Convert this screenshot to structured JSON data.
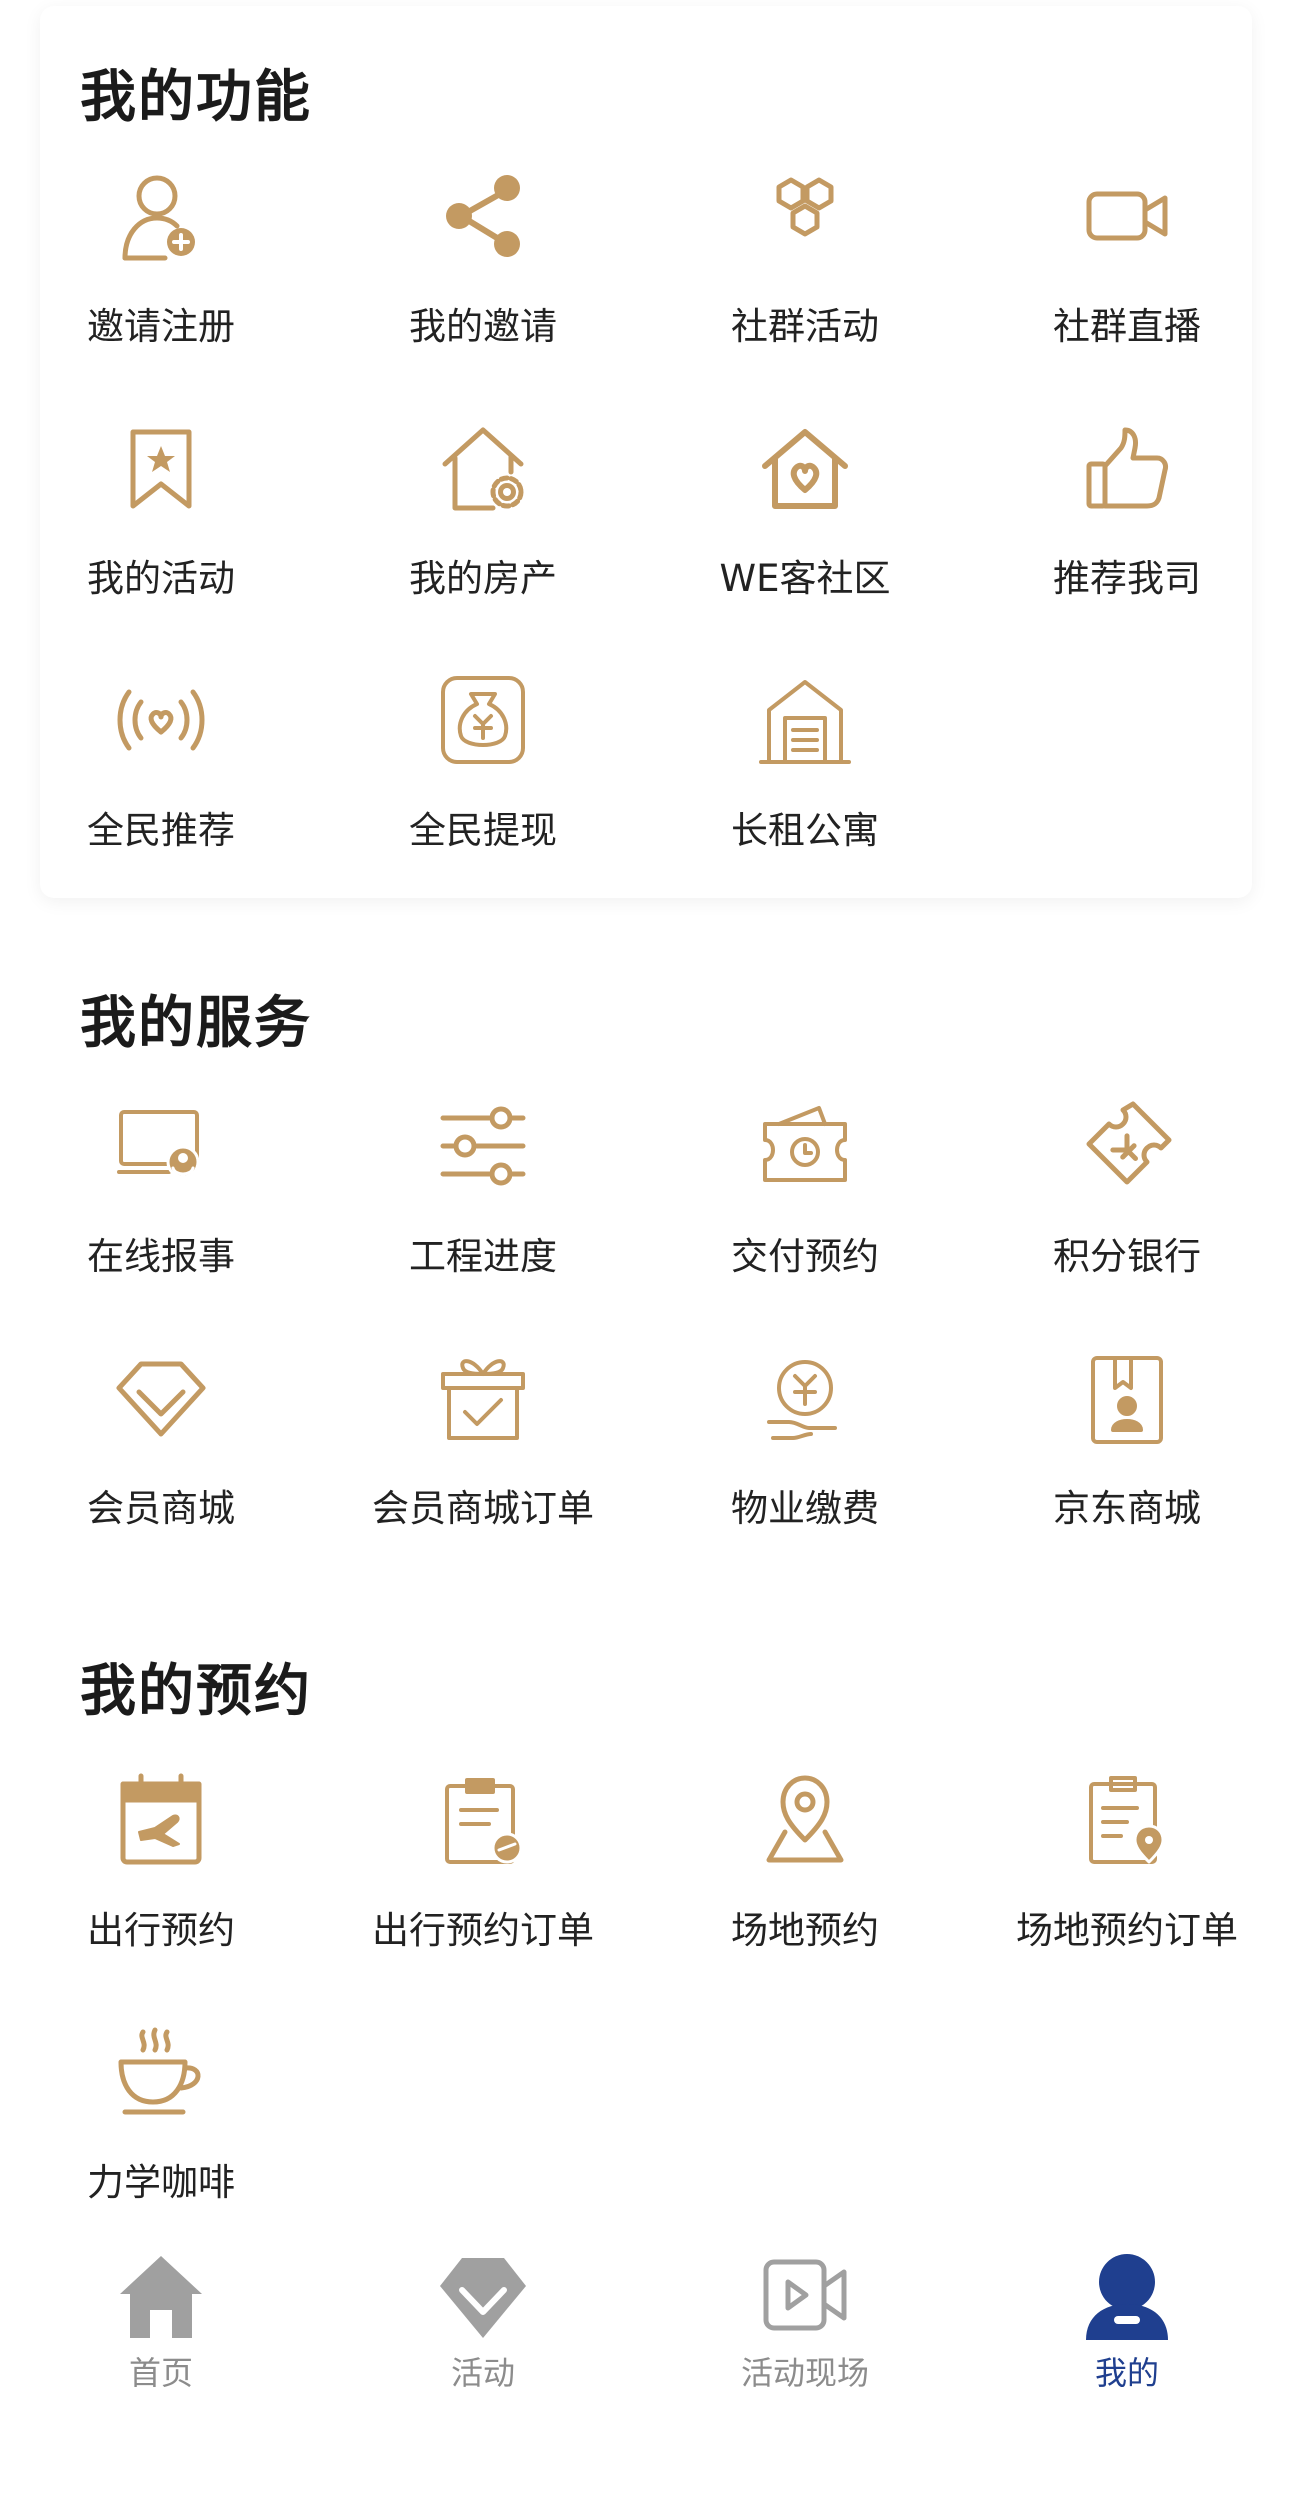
{
  "colors": {
    "accent": "#c39a62",
    "tab_inactive": "#a0a0a0",
    "tab_active": "#1f3f8f",
    "title": "#1b1b1b",
    "label": "#222222"
  },
  "functions": {
    "title": "我的功能",
    "items": [
      {
        "label": "邀请注册",
        "icon": "user-add-icon"
      },
      {
        "label": "我的邀请",
        "icon": "share-icon"
      },
      {
        "label": "社群活动",
        "icon": "hexagons-icon"
      },
      {
        "label": "社群直播",
        "icon": "video-camera-icon"
      },
      {
        "label": "我的活动",
        "icon": "bookmark-star-icon"
      },
      {
        "label": "我的房产",
        "icon": "house-gear-icon"
      },
      {
        "label": "WE客社区",
        "icon": "house-heart-icon"
      },
      {
        "label": "推荐我司",
        "icon": "thumbs-up-icon"
      },
      {
        "label": "全民推荐",
        "icon": "broadcast-heart-icon"
      },
      {
        "label": "全民提现",
        "icon": "money-bag-icon"
      },
      {
        "label": "长租公寓",
        "icon": "apartment-icon"
      }
    ]
  },
  "services": {
    "title": "我的服务",
    "items": [
      {
        "label": "在线报事",
        "icon": "monitor-service-icon"
      },
      {
        "label": "工程进度",
        "icon": "sliders-icon"
      },
      {
        "label": "交付预约",
        "icon": "ticket-clock-icon"
      },
      {
        "label": "积分银行",
        "icon": "coupon-yen-icon"
      },
      {
        "label": "会员商城",
        "icon": "diamond-icon"
      },
      {
        "label": "会员商城订单",
        "icon": "gift-check-icon"
      },
      {
        "label": "物业缴费",
        "icon": "hand-coin-icon"
      },
      {
        "label": "京东商城",
        "icon": "id-card-icon"
      }
    ]
  },
  "appointments": {
    "title": "我的预约",
    "items": [
      {
        "label": "出行预约",
        "icon": "calendar-plane-icon"
      },
      {
        "label": "出行预约订单",
        "icon": "clipboard-plane-icon"
      },
      {
        "label": "场地预约",
        "icon": "map-pin-icon"
      },
      {
        "label": "场地预约订单",
        "icon": "clipboard-pin-icon"
      },
      {
        "label": "力学咖啡",
        "icon": "coffee-cup-icon"
      }
    ]
  },
  "tabbar": {
    "tabs": [
      {
        "label": "首页",
        "icon": "home-icon",
        "active": false
      },
      {
        "label": "活动",
        "icon": "diamond-badge-icon",
        "active": false
      },
      {
        "label": "活动现场",
        "icon": "video-play-icon",
        "active": false
      },
      {
        "label": "我的",
        "icon": "user-icon",
        "active": true
      }
    ]
  }
}
